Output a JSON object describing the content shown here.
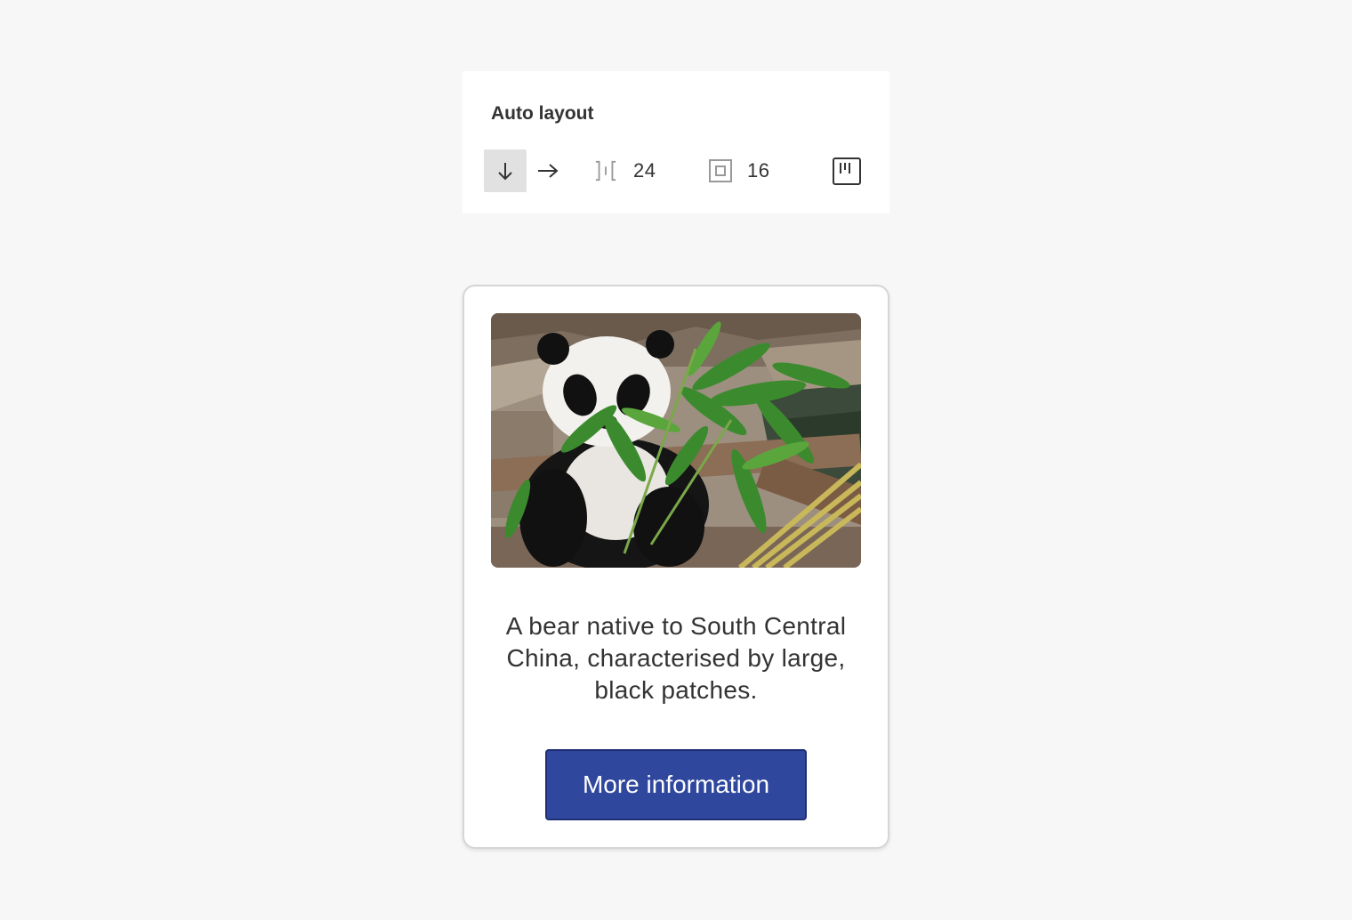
{
  "panel": {
    "title": "Auto layout",
    "direction": {
      "selected": "vertical",
      "options": [
        "vertical",
        "horizontal"
      ]
    },
    "spacing": {
      "value": "24",
      "icon": "item-spacing-icon"
    },
    "padding": {
      "value": "16",
      "icon": "padding-icon"
    },
    "alignment": {
      "icon": "alignment-icon"
    }
  },
  "card": {
    "image": {
      "alt": "Giant panda eating bamboo"
    },
    "description": "A bear native to South Central China, characterised by large, black patches.",
    "button_label": "More information"
  },
  "colors": {
    "background": "#f7f7f7",
    "panel": "#ffffff",
    "selected_toggle": "#e1e1e1",
    "button": "#2f479d",
    "text": "#333333",
    "card_border": "#d6d6d6"
  }
}
